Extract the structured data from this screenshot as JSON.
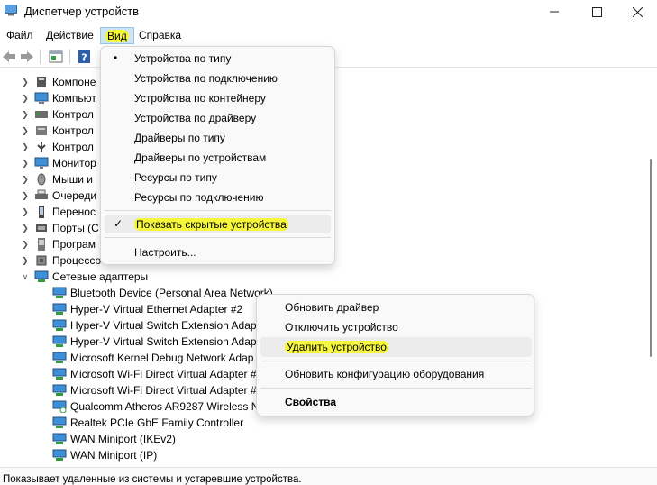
{
  "window": {
    "title": "Диспетчер устройств"
  },
  "menubar": {
    "items": [
      {
        "label": "Файл"
      },
      {
        "label": "Действие"
      },
      {
        "label": "Вид"
      },
      {
        "label": "Справка"
      }
    ]
  },
  "tree": {
    "categories": [
      {
        "label": "Компоне",
        "icon": "system-devices-icon"
      },
      {
        "label": "Компьют",
        "icon": "computer-icon"
      },
      {
        "label": "Контрол",
        "icon": "storage-controller-icon"
      },
      {
        "label": "Контрол",
        "icon": "ide-controller-icon"
      },
      {
        "label": "Контрол",
        "icon": "usb-controller-icon"
      },
      {
        "label": "Монитор",
        "icon": "monitor-icon"
      },
      {
        "label": "Мыши и",
        "icon": "mouse-icon"
      },
      {
        "label": "Очереди",
        "icon": "printer-icon"
      },
      {
        "label": "Перенос",
        "icon": "portable-device-icon"
      },
      {
        "label": "Порты (С",
        "icon": "port-icon"
      },
      {
        "label": "Програм",
        "icon": "software-device-icon"
      },
      {
        "label": "Процессо",
        "icon": "processor-icon"
      }
    ],
    "network": {
      "label": "Сетевые адаптеры",
      "children": [
        "Bluetooth Device (Personal Area Network)",
        "Hyper-V Virtual Ethernet Adapter #2",
        "Hyper-V Virtual Switch Extension Adap",
        "Hyper-V Virtual Switch Extension Adap",
        "Microsoft Kernel Debug Network Adap",
        "Microsoft Wi-Fi Direct Virtual Adapter #",
        "Microsoft Wi-Fi Direct Virtual Adapter #",
        "Qualcomm Atheros AR9287 Wireless N",
        "Realtek PCIe GbE Family Controller",
        "WAN Miniport (IKEv2)",
        "WAN Miniport (IP)"
      ]
    }
  },
  "view_menu": {
    "items": [
      {
        "label": "Устройства по типу",
        "bullet": "•"
      },
      {
        "label": "Устройства по подключению"
      },
      {
        "label": "Устройства по контейнеру"
      },
      {
        "label": "Устройства по драйверу"
      },
      {
        "label": "Драйверы по типу"
      },
      {
        "label": "Драйверы по устройствам"
      },
      {
        "label": "Ресурсы по типу"
      },
      {
        "label": "Ресурсы по подключению"
      }
    ],
    "show_hidden": {
      "label": "Показать скрытые устройства",
      "check": "✓"
    },
    "customize": {
      "label": "Настроить..."
    }
  },
  "context_menu": {
    "items": [
      {
        "label": "Обновить драйвер"
      },
      {
        "label": "Отключить устройство"
      },
      {
        "label": "Удалить устройство"
      },
      {
        "label": "Обновить конфигурацию оборудования"
      },
      {
        "label": "Свойства"
      }
    ]
  },
  "statusbar": {
    "text": "Показывает удаленные из системы и устаревшие устройства."
  },
  "colors": {
    "highlight": "#f6f63a",
    "menu_active": "#cce4f7"
  }
}
